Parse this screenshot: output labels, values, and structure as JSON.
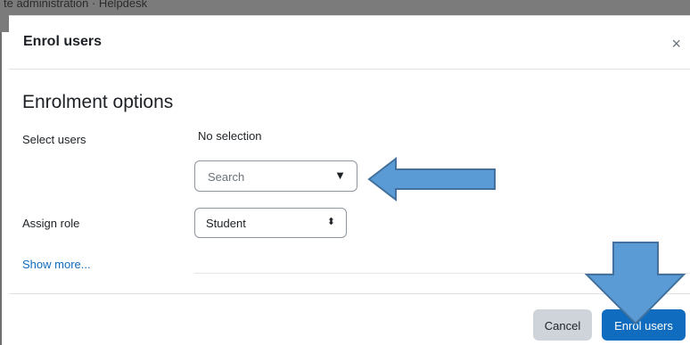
{
  "background": {
    "breadcrumb_text": "te administration · Helpdesk"
  },
  "modal": {
    "title": "Enrol users",
    "close_symbol": "×",
    "section_title": "Enrolment options",
    "select_users": {
      "label": "Select users",
      "value": "No selection"
    },
    "search": {
      "placeholder": "Search",
      "caret": "▼"
    },
    "assign_role": {
      "label": "Assign role",
      "selected": "Student",
      "caret": "⬍"
    },
    "show_more": "Show more...",
    "footer": {
      "cancel_label": "Cancel",
      "enrol_label": "Enrol users"
    }
  },
  "colors": {
    "primary": "#0f6cbf",
    "secondary": "#ced4da",
    "annotation_arrow": "#5b9bd5",
    "annotation_arrow_border": "#41719c"
  }
}
